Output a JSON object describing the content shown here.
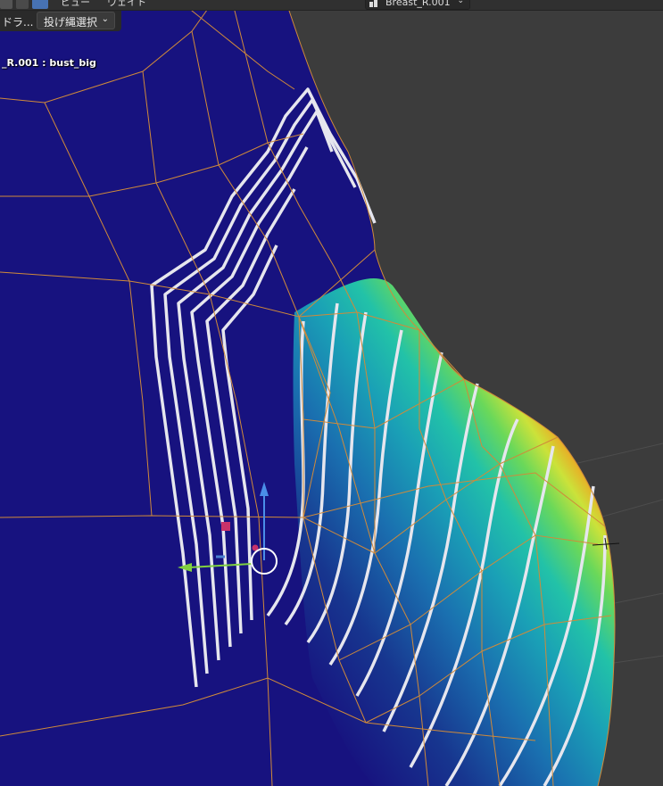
{
  "header": {
    "menu_view": "ビュー",
    "menu_weight": "ウェイト",
    "active_object": "Breast_R.001"
  },
  "toolbar": {
    "drag_label": "ドラ...",
    "selection_mode": "投げ縄選択"
  },
  "viewport": {
    "object_info": "_R.001 : bust_big",
    "mode": "weight-paint",
    "gizmo": {
      "axes": [
        "x",
        "y",
        "z"
      ],
      "colors": {
        "x": "#80d040",
        "y": "#4a7fd0",
        "z": "#4a8ee8"
      }
    }
  },
  "colors": {
    "background": "#3c3c3c",
    "zero_weight": "#17127f",
    "wireframe": "#d08a3a",
    "weight_high": "#e82818"
  },
  "icons": [
    "select-box-icon",
    "tweak-icon",
    "object-data-icon",
    "chevron-down-icon"
  ]
}
